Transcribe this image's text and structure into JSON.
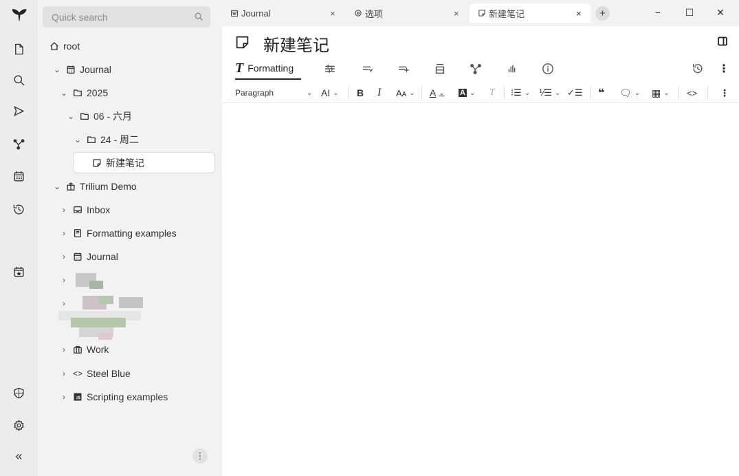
{
  "search": {
    "placeholder": "Quick search"
  },
  "tree": {
    "root": "root",
    "journal": "Journal",
    "year": "2025",
    "month": "06 - 六月",
    "day": "24 - 周二",
    "note": "新建笔记",
    "demo": "Trilium Demo",
    "inbox": "Inbox",
    "formatting_examples": "Formatting examples",
    "demo_journal": "Journal",
    "work": "Work",
    "steel_blue": "Steel Blue",
    "scripting_examples": "Scripting examples"
  },
  "tabs": [
    {
      "label": "Journal"
    },
    {
      "label": "选项"
    },
    {
      "label": "新建笔记"
    }
  ],
  "note": {
    "title": "新建笔记"
  },
  "ribbon": {
    "formatting_label": "Formatting"
  },
  "toolbar": {
    "paragraph": "Paragraph"
  }
}
